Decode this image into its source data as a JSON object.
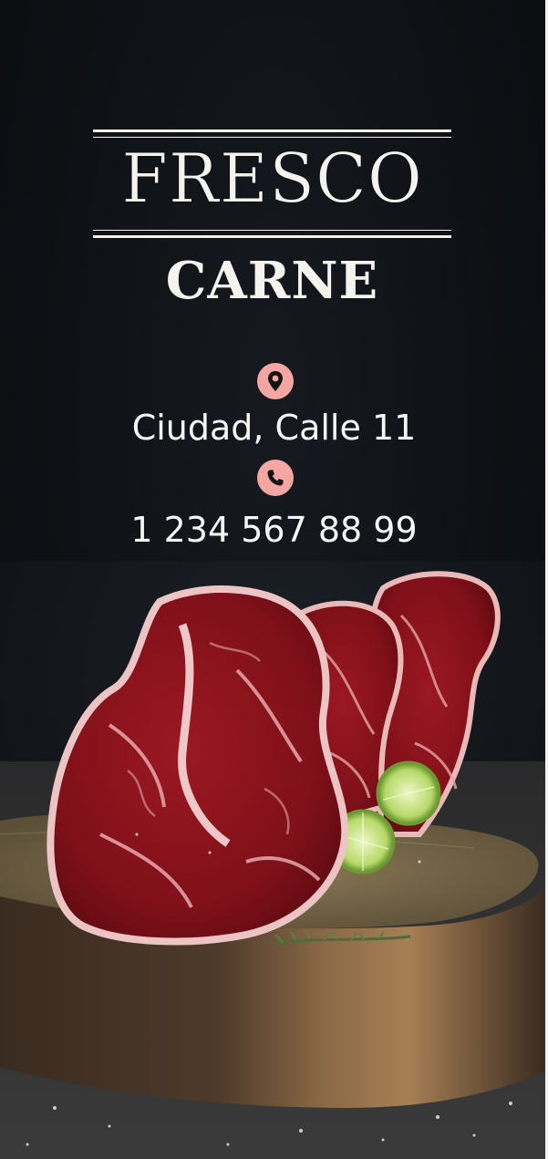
{
  "brand": {
    "title": "FRESCO",
    "subtitle": "CARNE"
  },
  "contact": {
    "address": "Ciudad, Calle 11",
    "address_icon": "location-pin-icon",
    "phone": "1 234 567 88 99",
    "phone_icon": "phone-icon",
    "icon_color": "#f4a7a2"
  },
  "photo": {
    "subject": "raw-steaks-on-wood-board-image"
  }
}
